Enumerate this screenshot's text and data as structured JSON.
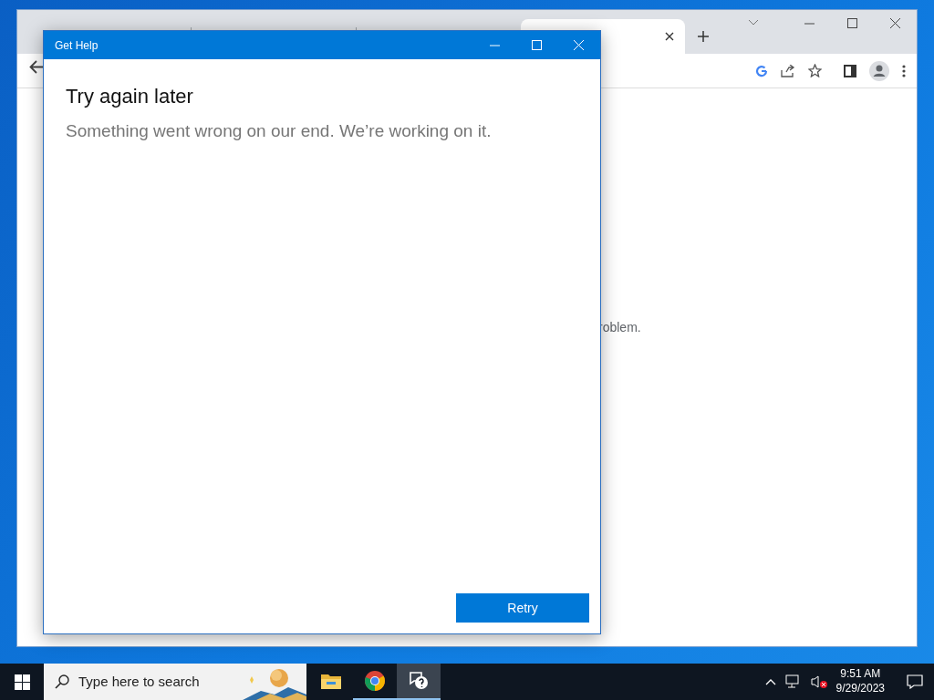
{
  "browser": {
    "body_text": "roblem."
  },
  "dialog": {
    "title": "Get Help",
    "heading": "Try again later",
    "message": "Something went wrong on our end. We’re working on it.",
    "button": "Retry"
  },
  "taskbar": {
    "search_placeholder": "Type here to search",
    "apps": [
      {
        "kind": "explorer",
        "running": false,
        "selected": false
      },
      {
        "kind": "chrome",
        "running": true,
        "selected": false
      },
      {
        "kind": "gethelp",
        "running": true,
        "selected": true
      }
    ],
    "time": "9:51 AM",
    "date": "9/29/2023"
  }
}
